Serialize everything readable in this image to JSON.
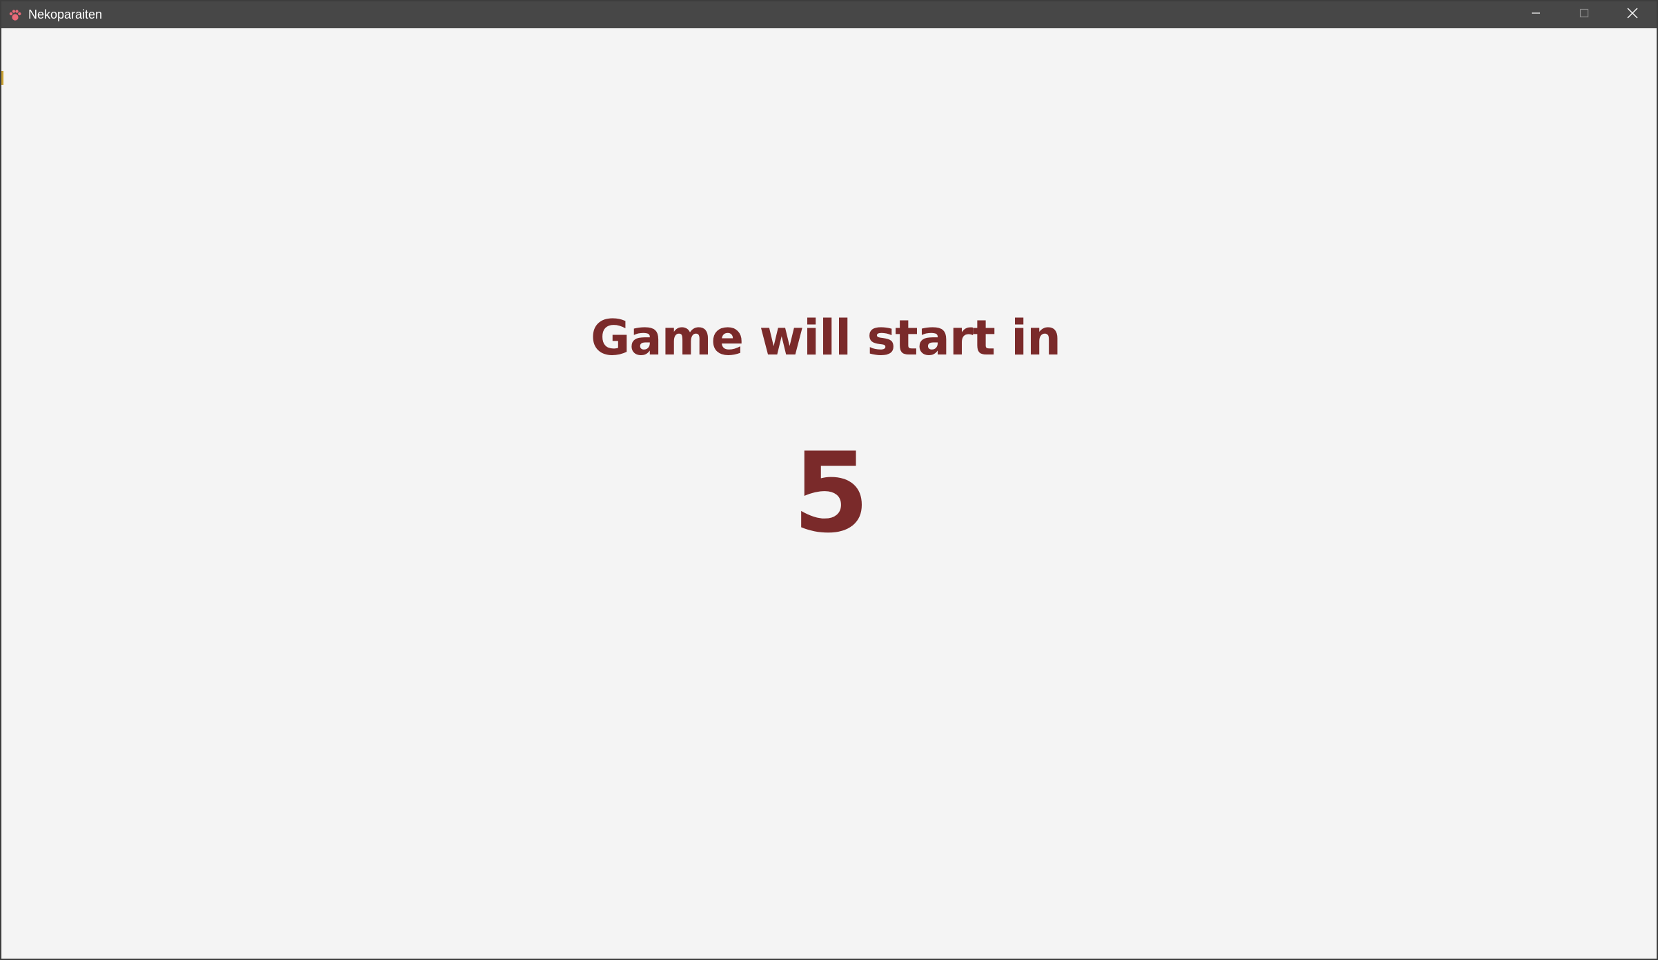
{
  "window": {
    "title": "Nekoparaiten",
    "icon": "paw-icon",
    "controls": [
      "minimize-icon",
      "maximize-icon",
      "close-icon"
    ]
  },
  "main": {
    "heading": "Game will start in",
    "countdown": "5"
  },
  "colors": {
    "titlebar": "#474747",
    "background": "#f4f4f4",
    "text": "#7a2a2a",
    "icon": "#e05a6a"
  }
}
